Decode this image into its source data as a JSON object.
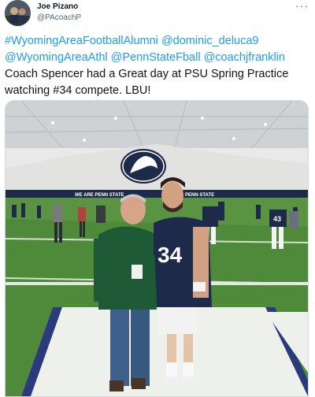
{
  "author": {
    "name": "Joe Pizano",
    "handle": "@PAcoachP",
    "avatar_icon": "profile-photo"
  },
  "menu": {
    "more_label": "···"
  },
  "tweet": {
    "links": [
      "#WyomingAreaFootballAlumni",
      "@dominic_deluca9",
      "@WyomingAreaAthl",
      "@PennStateFball",
      "@coachjfranklin"
    ],
    "text": "Coach Spencer had a Great day at PSU Spring Practice watching #34 compete. LBU!"
  },
  "photo": {
    "banner_left": "WE ARE PENN STATE",
    "banner_right": "PENN STATE",
    "jersey_number": "34",
    "jersey_number_back": "43"
  },
  "colors": {
    "link": "#1d9bf0",
    "navy": "#1e2a4a",
    "turf": "#4f8a3a"
  }
}
